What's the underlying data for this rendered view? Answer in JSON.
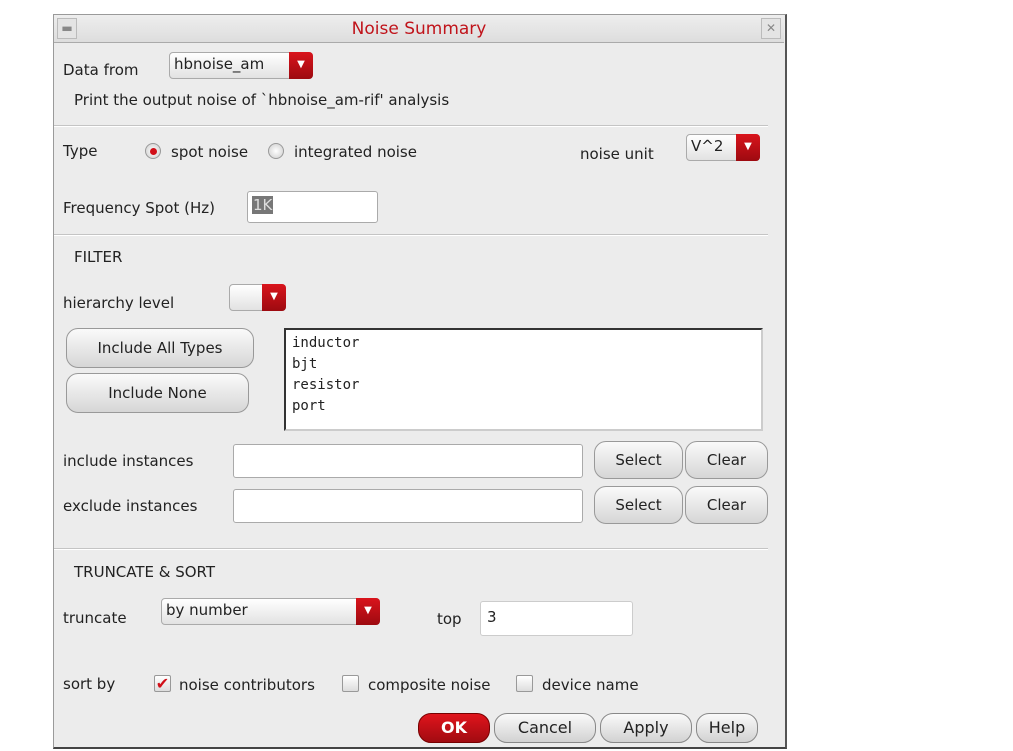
{
  "window": {
    "title": "Noise Summary",
    "minimize_icon": "minimize-icon",
    "close_icon": "close-icon"
  },
  "data_from": {
    "label": "Data from",
    "value": "hbnoise_am",
    "description": "Print the output noise of `hbnoise_am-rif' analysis"
  },
  "type": {
    "label": "Type",
    "options": [
      "spot noise",
      "integrated noise"
    ],
    "selected": "spot noise"
  },
  "noise_unit": {
    "label": "noise unit",
    "value": "V^2"
  },
  "frequency_spot": {
    "label": "Frequency Spot (Hz)",
    "value": "1K"
  },
  "filter": {
    "heading": "FILTER",
    "hierarchy_label": "hierarchy level",
    "hierarchy_value": "",
    "include_all": "Include All Types",
    "include_none": "Include None",
    "types": [
      "inductor",
      "bjt",
      "resistor",
      "port"
    ],
    "include_instances": {
      "label": "include instances",
      "value": "",
      "select": "Select",
      "clear": "Clear"
    },
    "exclude_instances": {
      "label": "exclude instances",
      "value": "",
      "select": "Select",
      "clear": "Clear"
    }
  },
  "truncate_sort": {
    "heading": "TRUNCATE & SORT",
    "truncate_label": "truncate",
    "truncate_value": "by number",
    "top_label": "top",
    "top_value": "3",
    "sort_label": "sort by",
    "sort_options": [
      {
        "label": "noise contributors",
        "checked": true
      },
      {
        "label": "composite noise",
        "checked": false
      },
      {
        "label": "device name",
        "checked": false
      }
    ]
  },
  "buttons": {
    "ok": "OK",
    "cancel": "Cancel",
    "apply": "Apply",
    "help": "Help"
  },
  "colors": {
    "accent": "#c0141b"
  }
}
